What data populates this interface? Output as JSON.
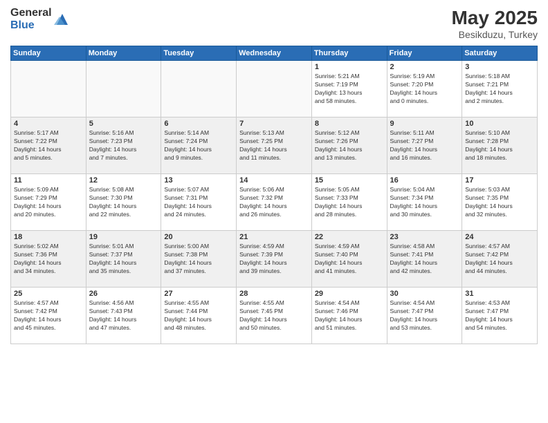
{
  "logo": {
    "general": "General",
    "blue": "Blue"
  },
  "title": "May 2025",
  "location": "Besikduzu, Turkey",
  "weekdays": [
    "Sunday",
    "Monday",
    "Tuesday",
    "Wednesday",
    "Thursday",
    "Friday",
    "Saturday"
  ],
  "weeks": [
    [
      {
        "day": "",
        "info": ""
      },
      {
        "day": "",
        "info": ""
      },
      {
        "day": "",
        "info": ""
      },
      {
        "day": "",
        "info": ""
      },
      {
        "day": "1",
        "info": "Sunrise: 5:21 AM\nSunset: 7:19 PM\nDaylight: 13 hours\nand 58 minutes."
      },
      {
        "day": "2",
        "info": "Sunrise: 5:19 AM\nSunset: 7:20 PM\nDaylight: 14 hours\nand 0 minutes."
      },
      {
        "day": "3",
        "info": "Sunrise: 5:18 AM\nSunset: 7:21 PM\nDaylight: 14 hours\nand 2 minutes."
      }
    ],
    [
      {
        "day": "4",
        "info": "Sunrise: 5:17 AM\nSunset: 7:22 PM\nDaylight: 14 hours\nand 5 minutes."
      },
      {
        "day": "5",
        "info": "Sunrise: 5:16 AM\nSunset: 7:23 PM\nDaylight: 14 hours\nand 7 minutes."
      },
      {
        "day": "6",
        "info": "Sunrise: 5:14 AM\nSunset: 7:24 PM\nDaylight: 14 hours\nand 9 minutes."
      },
      {
        "day": "7",
        "info": "Sunrise: 5:13 AM\nSunset: 7:25 PM\nDaylight: 14 hours\nand 11 minutes."
      },
      {
        "day": "8",
        "info": "Sunrise: 5:12 AM\nSunset: 7:26 PM\nDaylight: 14 hours\nand 13 minutes."
      },
      {
        "day": "9",
        "info": "Sunrise: 5:11 AM\nSunset: 7:27 PM\nDaylight: 14 hours\nand 16 minutes."
      },
      {
        "day": "10",
        "info": "Sunrise: 5:10 AM\nSunset: 7:28 PM\nDaylight: 14 hours\nand 18 minutes."
      }
    ],
    [
      {
        "day": "11",
        "info": "Sunrise: 5:09 AM\nSunset: 7:29 PM\nDaylight: 14 hours\nand 20 minutes."
      },
      {
        "day": "12",
        "info": "Sunrise: 5:08 AM\nSunset: 7:30 PM\nDaylight: 14 hours\nand 22 minutes."
      },
      {
        "day": "13",
        "info": "Sunrise: 5:07 AM\nSunset: 7:31 PM\nDaylight: 14 hours\nand 24 minutes."
      },
      {
        "day": "14",
        "info": "Sunrise: 5:06 AM\nSunset: 7:32 PM\nDaylight: 14 hours\nand 26 minutes."
      },
      {
        "day": "15",
        "info": "Sunrise: 5:05 AM\nSunset: 7:33 PM\nDaylight: 14 hours\nand 28 minutes."
      },
      {
        "day": "16",
        "info": "Sunrise: 5:04 AM\nSunset: 7:34 PM\nDaylight: 14 hours\nand 30 minutes."
      },
      {
        "day": "17",
        "info": "Sunrise: 5:03 AM\nSunset: 7:35 PM\nDaylight: 14 hours\nand 32 minutes."
      }
    ],
    [
      {
        "day": "18",
        "info": "Sunrise: 5:02 AM\nSunset: 7:36 PM\nDaylight: 14 hours\nand 34 minutes."
      },
      {
        "day": "19",
        "info": "Sunrise: 5:01 AM\nSunset: 7:37 PM\nDaylight: 14 hours\nand 35 minutes."
      },
      {
        "day": "20",
        "info": "Sunrise: 5:00 AM\nSunset: 7:38 PM\nDaylight: 14 hours\nand 37 minutes."
      },
      {
        "day": "21",
        "info": "Sunrise: 4:59 AM\nSunset: 7:39 PM\nDaylight: 14 hours\nand 39 minutes."
      },
      {
        "day": "22",
        "info": "Sunrise: 4:59 AM\nSunset: 7:40 PM\nDaylight: 14 hours\nand 41 minutes."
      },
      {
        "day": "23",
        "info": "Sunrise: 4:58 AM\nSunset: 7:41 PM\nDaylight: 14 hours\nand 42 minutes."
      },
      {
        "day": "24",
        "info": "Sunrise: 4:57 AM\nSunset: 7:42 PM\nDaylight: 14 hours\nand 44 minutes."
      }
    ],
    [
      {
        "day": "25",
        "info": "Sunrise: 4:57 AM\nSunset: 7:42 PM\nDaylight: 14 hours\nand 45 minutes."
      },
      {
        "day": "26",
        "info": "Sunrise: 4:56 AM\nSunset: 7:43 PM\nDaylight: 14 hours\nand 47 minutes."
      },
      {
        "day": "27",
        "info": "Sunrise: 4:55 AM\nSunset: 7:44 PM\nDaylight: 14 hours\nand 48 minutes."
      },
      {
        "day": "28",
        "info": "Sunrise: 4:55 AM\nSunset: 7:45 PM\nDaylight: 14 hours\nand 50 minutes."
      },
      {
        "day": "29",
        "info": "Sunrise: 4:54 AM\nSunset: 7:46 PM\nDaylight: 14 hours\nand 51 minutes."
      },
      {
        "day": "30",
        "info": "Sunrise: 4:54 AM\nSunset: 7:47 PM\nDaylight: 14 hours\nand 53 minutes."
      },
      {
        "day": "31",
        "info": "Sunrise: 4:53 AM\nSunset: 7:47 PM\nDaylight: 14 hours\nand 54 minutes."
      }
    ]
  ]
}
